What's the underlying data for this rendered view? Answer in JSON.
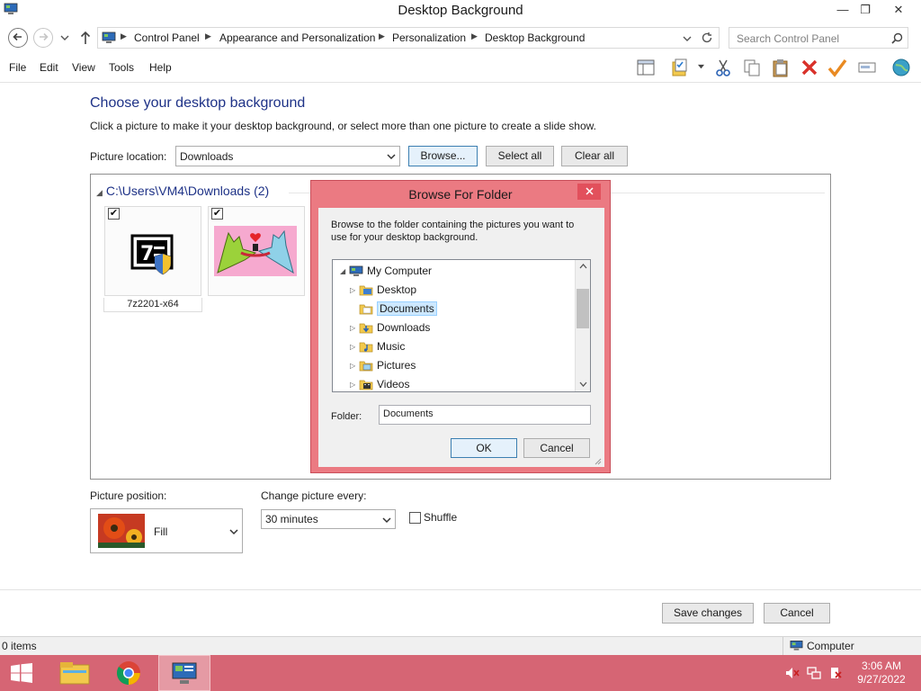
{
  "window": {
    "title": "Desktop Background",
    "minimize_glyph": "—",
    "restore_glyph": "❐",
    "close_glyph": "✕"
  },
  "navigation": {
    "back_icon": "back-arrow-icon",
    "forward_icon": "forward-arrow-icon",
    "up_icon": "up-arrow-icon",
    "breadcrumbs": [
      "Control Panel",
      "Appearance and Personalization",
      "Personalization",
      "Desktop Background"
    ],
    "search_placeholder": "Search Control Panel"
  },
  "menu": [
    "File",
    "Edit",
    "View",
    "Tools",
    "Help"
  ],
  "toolbar_icons": [
    "layout-icon",
    "properties-icon",
    "cut-icon",
    "copy-icon",
    "paste-icon",
    "delete-icon",
    "check-icon",
    "rename-icon",
    "globe-icon"
  ],
  "main": {
    "heading": "Choose your desktop background",
    "subtitle": "Click a picture to make it your desktop background, or select more than one picture to create a slide show.",
    "location_label": "Picture location:",
    "location_value": "Downloads",
    "browse_label": "Browse...",
    "select_all_label": "Select all",
    "clear_all_label": "Clear all",
    "group_header": "C:\\Users\\VM4\\Downloads (2)",
    "pictures": [
      {
        "name": "7z2201-x64",
        "checked": true
      },
      {
        "name": "",
        "checked": true
      }
    ],
    "position_label": "Picture position:",
    "position_value": "Fill",
    "change_label": "Change picture every:",
    "change_value": "30 minutes",
    "shuffle_label": "Shuffle",
    "save_label": "Save changes",
    "cancel_label": "Cancel"
  },
  "dialog": {
    "title": "Browse For Folder",
    "description": "Browse to the folder containing the pictures you want to use for your desktop background.",
    "tree": [
      {
        "label": "My Computer",
        "level": 0,
        "expanded": true,
        "icon": "computer-icon"
      },
      {
        "label": "Desktop",
        "level": 1,
        "icon": "folder-icon"
      },
      {
        "label": "Documents",
        "level": 1,
        "selected": true,
        "icon": "folder-icon"
      },
      {
        "label": "Downloads",
        "level": 1,
        "icon": "download-folder-icon"
      },
      {
        "label": "Music",
        "level": 1,
        "icon": "music-folder-icon"
      },
      {
        "label": "Pictures",
        "level": 1,
        "icon": "pictures-folder-icon"
      },
      {
        "label": "Videos",
        "level": 1,
        "icon": "videos-folder-icon"
      }
    ],
    "folder_label": "Folder:",
    "folder_value": "Documents",
    "ok_label": "OK",
    "cancel_label": "Cancel"
  },
  "status": {
    "items": "0 items",
    "location": "Computer"
  },
  "taskbar": {
    "time": "3:06 AM",
    "date": "9/27/2022",
    "apps": [
      "file-explorer-icon",
      "chrome-icon",
      "control-panel-icon"
    ]
  },
  "colors": {
    "heading": "#1e3287",
    "dialog_frame": "#eb7a82",
    "taskbar": "#d66574"
  }
}
